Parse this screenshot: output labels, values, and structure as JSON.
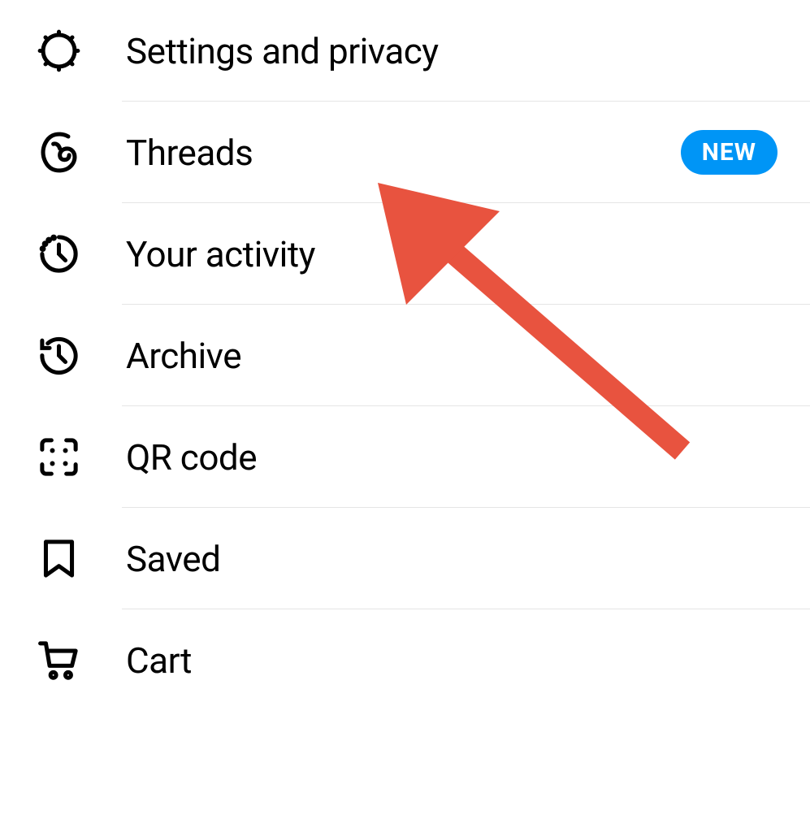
{
  "menu": {
    "items": [
      {
        "id": "settings",
        "label": "Settings and privacy",
        "icon": "gear-icon",
        "badge": null
      },
      {
        "id": "threads",
        "label": "Threads",
        "icon": "threads-icon",
        "badge": "NEW"
      },
      {
        "id": "activity",
        "label": "Your activity",
        "icon": "activity-icon",
        "badge": null
      },
      {
        "id": "archive",
        "label": "Archive",
        "icon": "archive-icon",
        "badge": null
      },
      {
        "id": "qrcode",
        "label": "QR code",
        "icon": "qrcode-icon",
        "badge": null
      },
      {
        "id": "saved",
        "label": "Saved",
        "icon": "bookmark-icon",
        "badge": null
      },
      {
        "id": "cart",
        "label": "Cart",
        "icon": "cart-icon",
        "badge": null
      }
    ]
  },
  "colors": {
    "badge_bg": "#0095f6",
    "badge_text": "#ffffff",
    "arrow": "#e74c3c",
    "text": "#000000",
    "divider": "#e5e5e5"
  }
}
